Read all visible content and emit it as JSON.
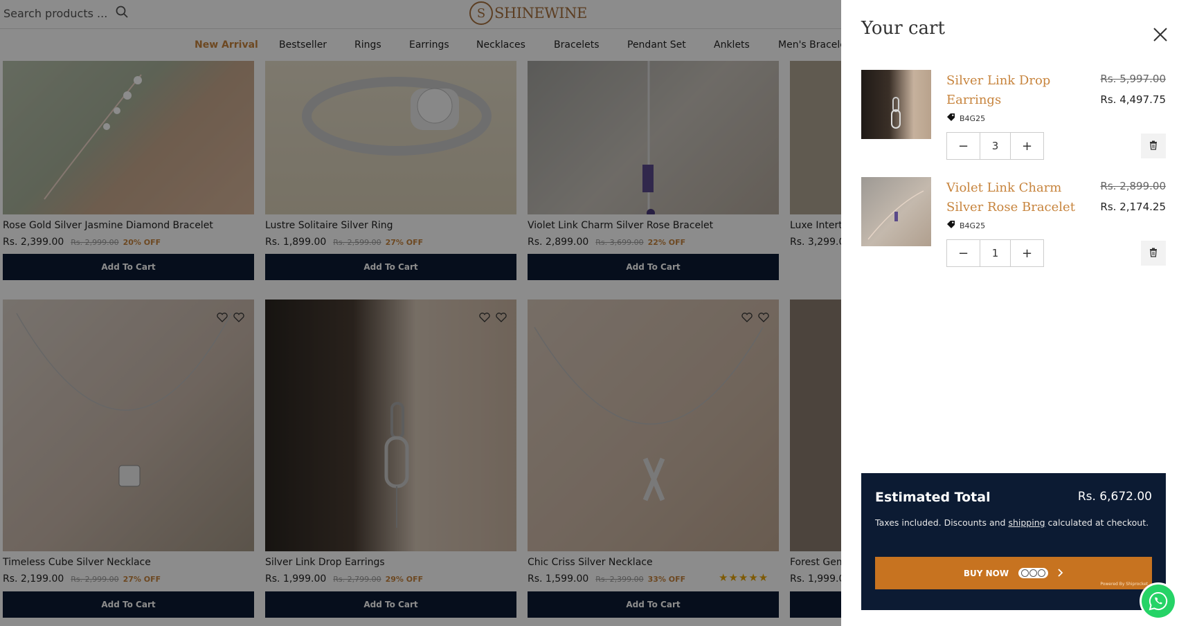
{
  "header": {
    "search_placeholder": "Search products ...",
    "logo_text": "SHINEWINE",
    "logo_letter": "S"
  },
  "nav": {
    "items": [
      "New Arrival",
      "Bestseller",
      "Rings",
      "Earrings",
      "Necklaces",
      "Bracelets",
      "Pendant Set",
      "Anklets",
      "Men's Bracele"
    ],
    "active_index": 0
  },
  "products": [
    {
      "name": "Rose Gold Silver Jasmine Diamond Bracelet",
      "price": "Rs. 2,399.00",
      "old": "Rs. 2,999.00",
      "off": "20% OFF",
      "button": "Add To Cart"
    },
    {
      "name": "Lustre Solitaire Silver Ring",
      "price": "Rs. 1,899.00",
      "old": "Rs. 2,599.00",
      "off": "27% OFF",
      "button": "Add To Cart"
    },
    {
      "name": "Violet Link Charm Silver Rose Bracelet",
      "price": "Rs. 2,899.00",
      "old": "Rs. 3,699.00",
      "off": "22% OFF",
      "button": "Add To Cart"
    },
    {
      "name": "Luxe Intert",
      "price": "Rs. 3,299.0",
      "button": ""
    },
    {
      "name": "Timeless Cube Silver Necklace",
      "price": "Rs. 2,199.00",
      "old": "Rs. 2,999.00",
      "off": "27% OFF",
      "button": "Add To Cart"
    },
    {
      "name": "Silver Link Drop Earrings",
      "price": "Rs. 1,999.00",
      "old": "Rs. 2,799.00",
      "off": "29% OFF",
      "button": "Add To Cart"
    },
    {
      "name": "Chic Criss Silver Necklace",
      "price": "Rs. 1,599.00",
      "old": "Rs. 2,399.00",
      "off": "33% OFF",
      "button": "Add To Cart",
      "rating": 5
    },
    {
      "name": "Forest Gem",
      "price": "Rs. 1,999.0",
      "button": ""
    }
  ],
  "cart": {
    "title": "Your cart",
    "items": [
      {
        "name": "Silver Link Drop Earrings",
        "old_price": "Rs. 5,997.00",
        "price": "Rs. 4,497.75",
        "code": "B4G25",
        "qty": "3"
      },
      {
        "name": "Violet Link Charm Silver Rose Bracelet",
        "old_price": "Rs. 2,899.00",
        "price": "Rs. 2,174.25",
        "code": "B4G25",
        "qty": "1"
      }
    ],
    "summary": {
      "label": "Estimated Total",
      "value": "Rs. 6,672.00",
      "note_before": "Taxes included. Discounts and ",
      "note_link": "shipping",
      "note_after": " calculated at checkout.",
      "buy_label": "BUY NOW",
      "powered_by": "Powered By Shiprocket"
    }
  },
  "colors": {
    "accent": "#c7843d",
    "navy": "#0c1b33",
    "buy": "#c77320",
    "whatsapp": "#25d366"
  }
}
